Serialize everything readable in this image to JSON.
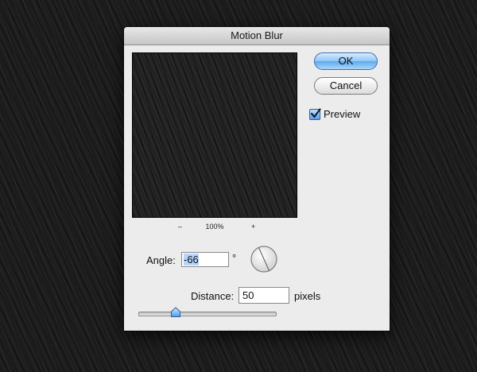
{
  "dialog": {
    "title": "Motion Blur",
    "ok_label": "OK",
    "cancel_label": "Cancel",
    "preview_label": "Preview",
    "preview_checked": true,
    "zoom": {
      "minus": "–",
      "level": "100%",
      "plus": "+"
    },
    "angle": {
      "label": "Angle:",
      "value": "-66",
      "unit": "°"
    },
    "distance": {
      "label": "Distance:",
      "value": "50",
      "unit": "pixels",
      "slider_fraction": 0.24
    }
  },
  "colors": {
    "accent": "#5fa9ec",
    "dialog_bg": "#ececec",
    "background": "#1c1c1c"
  },
  "icons": {
    "dial": "angle-dial-icon",
    "check": "checkmark-icon",
    "thumb": "slider-thumb-icon"
  }
}
